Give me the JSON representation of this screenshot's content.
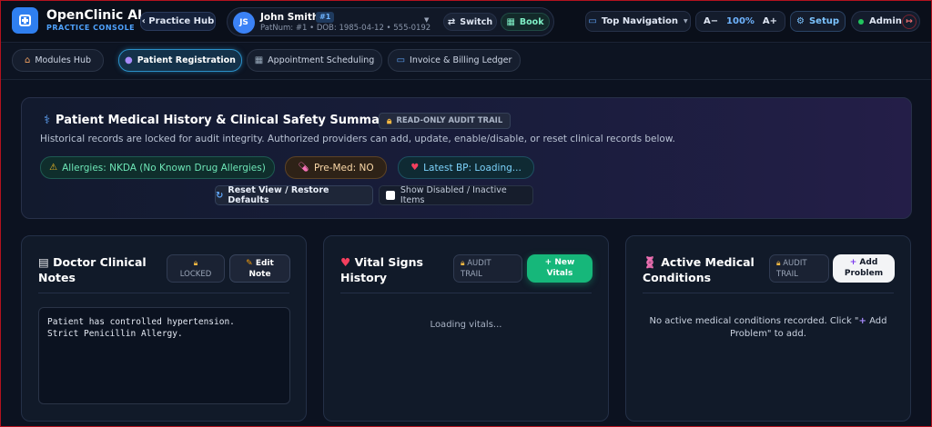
{
  "brand": {
    "title": "OpenClinic AI",
    "subtitle": "PRACTICE CONSOLE"
  },
  "header": {
    "practice_hub": "‹ Practice Hub",
    "patient": {
      "initials": "JS",
      "name": "John Smith",
      "badge": "#1",
      "meta": "PatNum: #1 • DOB: 1985-04-12 • 555-0192",
      "switch_label": "Switch",
      "book_label": "Book"
    },
    "nav_mode": "Top Navigation",
    "zoom": {
      "minus": "A−",
      "value": "100%",
      "plus": "A+"
    },
    "setup_label": "Setup",
    "user_label": "Admin"
  },
  "tabs": [
    {
      "label": "Modules Hub",
      "icon": "house-icon",
      "active": false
    },
    {
      "label": "Patient Registration",
      "icon": "user-icon",
      "active": true
    },
    {
      "label": "Appointment Scheduling",
      "icon": "calendar-icon",
      "active": false
    },
    {
      "label": "Invoice & Billing Ledger",
      "icon": "credit-card-icon",
      "active": false
    }
  ],
  "summary": {
    "title": "Patient Medical History & Clinical Safety Summary",
    "badge": "READ-ONLY AUDIT TRAIL",
    "description": "Historical records are locked for audit integrity. Authorized providers can add, update, enable/disable, or reset clinical records below.",
    "allergies": "Allergies: NKDA (No Known Drug Allergies)",
    "premed": "Pre-Med: NO",
    "bp": "Latest BP: Loading...",
    "reset_label": "Reset View / Restore Defaults",
    "show_disabled_label": "Show Disabled / Inactive Items"
  },
  "cards": {
    "notes": {
      "title_line1": "Doctor Clinical",
      "title_line2": "Notes",
      "locked": "LOCKED",
      "edit_line1": "Edit",
      "edit_line2": "Note",
      "line1": "Patient has controlled hypertension.",
      "line2": "Strict Penicillin Allergy."
    },
    "vitals": {
      "title_line1": "Vital Signs",
      "title_line2": "History",
      "audit_line1": "AUDIT",
      "audit_line2": "TRAIL",
      "new_line1": "New",
      "new_line2": "Vitals",
      "loading": "Loading vitals..."
    },
    "conditions": {
      "title_line1": "Active Medical",
      "title_line2": "Conditions",
      "audit_line1": "AUDIT",
      "audit_line2": "TRAIL",
      "add_line1": "Add",
      "add_line2": "Problem",
      "empty_part1": "No active medical conditions recorded. Click \"",
      "empty_part2": " Add Problem\" to add."
    }
  },
  "colors": {
    "accent": "#2f7ff0",
    "success": "#16b77a",
    "danger": "#b3121e"
  }
}
